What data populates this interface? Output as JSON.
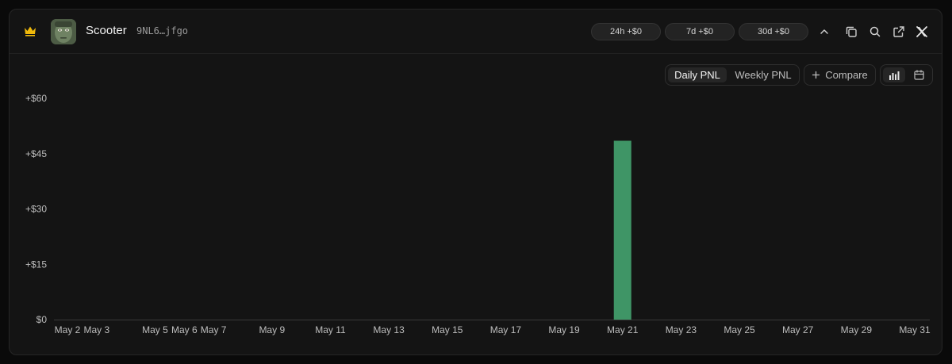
{
  "header": {
    "name": "Scooter",
    "address": "9NL6…jfgo",
    "pills": [
      {
        "label": "24h +$0"
      },
      {
        "label": "7d +$0"
      },
      {
        "label": "30d +$0"
      }
    ],
    "icons": [
      "chevron-up-icon",
      "copy-icon",
      "search-icon",
      "external-link-icon",
      "x-logo-icon"
    ]
  },
  "toolbar": {
    "tabs": [
      {
        "label": "Daily PNL",
        "active": true
      },
      {
        "label": "Weekly PNL",
        "active": false
      }
    ],
    "compare_label": "Compare",
    "view_icons": [
      "bar-chart-icon",
      "calendar-icon"
    ]
  },
  "colors": {
    "accent_gold": "#f0b90b",
    "bar_green": "#3f9566"
  },
  "chart_data": {
    "type": "bar",
    "y_tick_labels": [
      "+$60",
      "+$45",
      "+$30",
      "+$15",
      "$0"
    ],
    "y_tick_values": [
      60,
      45,
      30,
      15,
      0
    ],
    "ylim": [
      0,
      60
    ],
    "days": [
      2,
      3,
      4,
      5,
      6,
      7,
      8,
      9,
      10,
      11,
      12,
      13,
      14,
      15,
      16,
      17,
      18,
      19,
      20,
      21,
      22,
      23,
      24,
      25,
      26,
      27,
      28,
      29,
      30,
      31
    ],
    "x_tick_labels": [
      {
        "day": 2,
        "label": "May 2"
      },
      {
        "day": 3,
        "label": "May 3"
      },
      {
        "day": 5,
        "label": "May 5"
      },
      {
        "day": 6,
        "label": "May 6"
      },
      {
        "day": 7,
        "label": "May 7"
      },
      {
        "day": 9,
        "label": "May 9"
      },
      {
        "day": 11,
        "label": "May 11"
      },
      {
        "day": 13,
        "label": "May 13"
      },
      {
        "day": 15,
        "label": "May 15"
      },
      {
        "day": 17,
        "label": "May 17"
      },
      {
        "day": 19,
        "label": "May 19"
      },
      {
        "day": 21,
        "label": "May 21"
      },
      {
        "day": 23,
        "label": "May 23"
      },
      {
        "day": 25,
        "label": "May 25"
      },
      {
        "day": 27,
        "label": "May 27"
      },
      {
        "day": 29,
        "label": "May 29"
      },
      {
        "day": 31,
        "label": "May 31"
      }
    ],
    "values": [
      0,
      0,
      0,
      0,
      0,
      0,
      0,
      0,
      0,
      0,
      0,
      0,
      0,
      0,
      0,
      0,
      0,
      0,
      0,
      48.5,
      0,
      0,
      0,
      0,
      0,
      0,
      0,
      0,
      0,
      0
    ]
  }
}
